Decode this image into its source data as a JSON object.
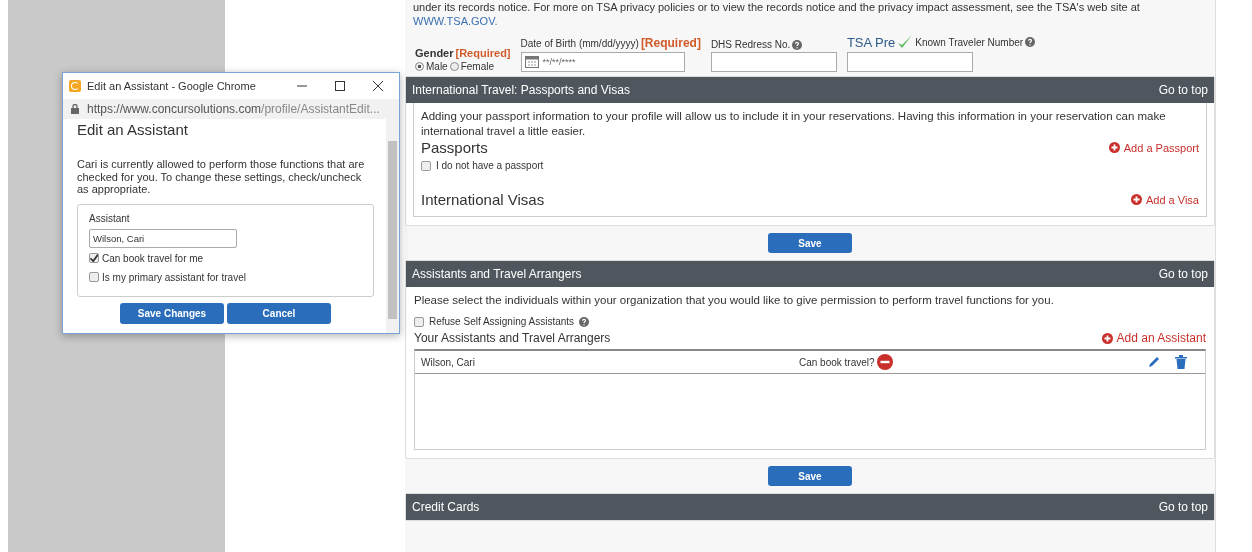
{
  "intro": {
    "text": "under its records notice. For more on TSA privacy policies or to view the records notice and the privacy impact assessment, see the TSA's web site at",
    "link": "WWW.TSA.GOV."
  },
  "traveler_form": {
    "gender": {
      "label": "Gender",
      "required": "[Required]",
      "options": [
        {
          "label": "Male",
          "selected": true
        },
        {
          "label": "Female",
          "selected": false
        }
      ]
    },
    "dob": {
      "label": "Date of Birth (mm/dd/yyyy)",
      "required": "[Required]",
      "value": "**/**/****"
    },
    "redress": {
      "label": "DHS Redress No."
    },
    "known_traveler": {
      "logo": "TSA Pre",
      "label": "Known Traveler Number"
    }
  },
  "sections": [
    {
      "kind": "passports",
      "title": "International Travel: Passports and Visas",
      "go_to_top": "Go to top",
      "description": "Adding your passport information to your profile will allow us to include it in your reservations. Having this information in your reservation can make international travel a little easier.",
      "passports_heading": "Passports",
      "add_passport": "Add a Passport",
      "no_passport": {
        "label": "I do not have a passport",
        "checked": false
      },
      "visas_heading": "International Visas",
      "add_visa": "Add a Visa",
      "save": "Save"
    },
    {
      "kind": "assistants",
      "title": "Assistants and Travel Arrangers",
      "go_to_top": "Go to top",
      "description": "Please select the individuals within your organization that you would like to give permission to perform travel functions for you.",
      "refuse": {
        "label": "Refuse Self Assigning Assistants",
        "checked": false
      },
      "list_heading": "Your Assistants and Travel Arrangers",
      "add_assistant": "Add an Assistant",
      "rows": [
        {
          "name": "Wilson, Cari",
          "permission": "Can book travel?"
        }
      ],
      "save": "Save"
    },
    {
      "kind": "header_only",
      "title": "Credit Cards",
      "go_to_top": "Go to top"
    }
  ],
  "popup": {
    "window_title": "Edit an Assistant - Google Chrome",
    "url_host": "https://www.concursolutions.com",
    "url_path": "/profile/AssistantEdit...",
    "heading": "Edit an Assistant",
    "description": "Cari is currently allowed to perform those functions that are checked for you. To change these settings, check/uncheck as appropriate.",
    "assistant_label": "Assistant",
    "assistant_value": "Wilson, Cari",
    "options": [
      {
        "label": "Can book travel for me",
        "checked": true
      },
      {
        "label": "Is my primary assistant for travel",
        "checked": false
      }
    ],
    "buttons": [
      "Save Changes",
      "Cancel"
    ]
  }
}
